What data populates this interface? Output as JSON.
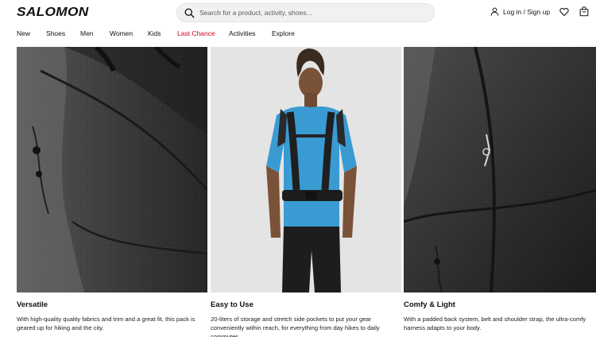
{
  "header": {
    "logo": "SALOMON",
    "search_placeholder": "Search for a product, activity, shoes...",
    "account_label": "Log in / Sign up",
    "icons": [
      "search-icon",
      "user-icon",
      "heart-icon",
      "bag-icon"
    ]
  },
  "nav": {
    "items": [
      "New",
      "Shoes",
      "Men",
      "Women",
      "Kids",
      "Last Chance",
      "Activities",
      "Explore"
    ],
    "sale_color": "#d0021b"
  },
  "features": [
    {
      "title": "Versatile",
      "text": "With high-quality quality fabrics and trim and a great fit, this pack is geared up for hiking and the city."
    },
    {
      "title": "Easy to Use",
      "text": "20-liters of storage and stretch side pockets to put your gear conveniently within reach, for everything from day hikes to daily commutes."
    },
    {
      "title": "Comfy & Light",
      "text": "With a padded back system, belt and shoulder strap, the ultra-comfy harness adapts to your body."
    }
  ],
  "colors": {
    "shirt": "#3a9bd3",
    "pack": "#2a2a2a"
  }
}
